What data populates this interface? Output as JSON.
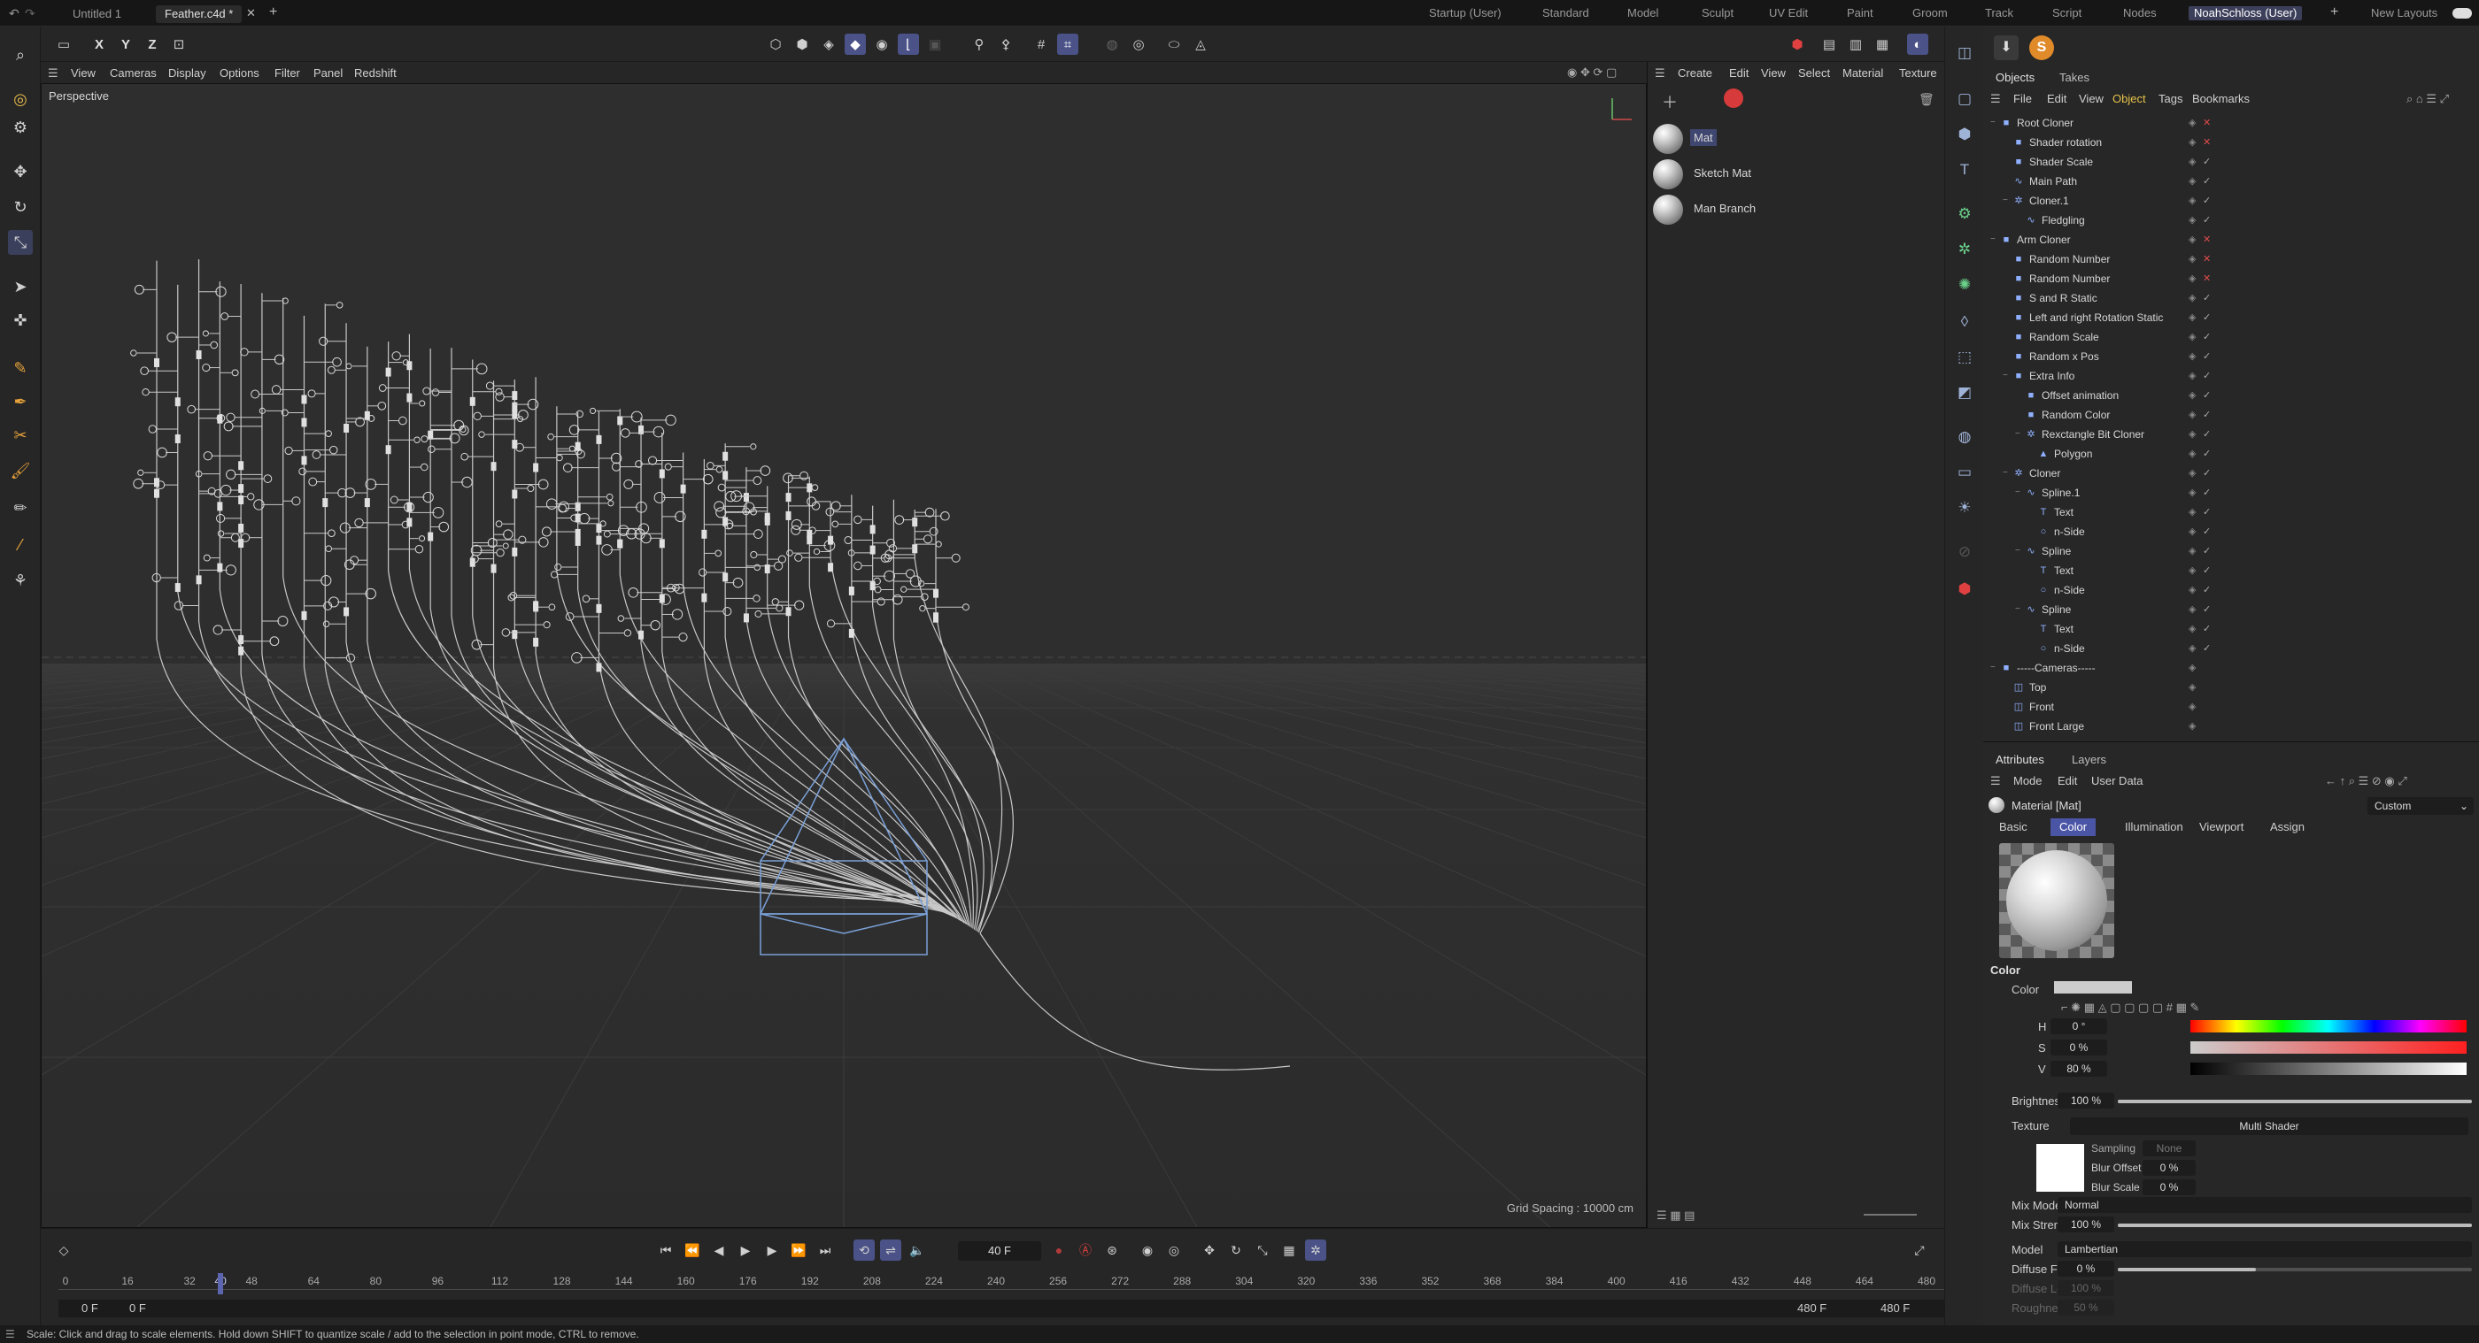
{
  "doc_tabs": [
    "Untitled 1",
    "Feather.c4d *"
  ],
  "layouts": [
    "Startup (User)",
    "Standard",
    "Model",
    "Sculpt",
    "UV Edit",
    "Paint",
    "Groom",
    "Track",
    "Script",
    "Nodes",
    "NoahSchloss (User)",
    "New Layouts"
  ],
  "axis_buttons": [
    "X",
    "Y",
    "Z"
  ],
  "viewport_menu": [
    "View",
    "Cameras",
    "Display",
    "Options",
    "Filter",
    "Panel",
    "Redshift"
  ],
  "viewport": {
    "label": "Perspective",
    "grid_spacing": "Grid Spacing : 10000 cm"
  },
  "material_menu": [
    "Create",
    "Edit",
    "View",
    "Select",
    "Material",
    "Texture"
  ],
  "materials": [
    "Mat",
    "Sketch Mat",
    "Man Branch"
  ],
  "obj_tabs": [
    "Objects",
    "Takes"
  ],
  "obj_menu": [
    "File",
    "Edit",
    "View",
    "Object",
    "Tags",
    "Bookmarks"
  ],
  "objects": [
    {
      "name": "Root Cloner",
      "depth": 0,
      "exp": "−",
      "icon": "■",
      "flag": "✕"
    },
    {
      "name": "Shader rotation",
      "depth": 1,
      "exp": "",
      "icon": "■",
      "flag": "✕"
    },
    {
      "name": "Shader Scale",
      "depth": 1,
      "exp": "",
      "icon": "■",
      "flag": "✓"
    },
    {
      "name": "Main Path",
      "depth": 1,
      "exp": "",
      "icon": "∿",
      "flag": "✓"
    },
    {
      "name": "Cloner.1",
      "depth": 1,
      "exp": "−",
      "icon": "✲",
      "flag": "✓"
    },
    {
      "name": "Fledgling",
      "depth": 2,
      "exp": "",
      "icon": "∿",
      "flag": "✓"
    },
    {
      "name": "Arm Cloner",
      "depth": 0,
      "exp": "−",
      "icon": "■",
      "flag": "✕"
    },
    {
      "name": "Random Number",
      "depth": 1,
      "exp": "",
      "icon": "■",
      "flag": "✕"
    },
    {
      "name": "Random Number",
      "depth": 1,
      "exp": "",
      "icon": "■",
      "flag": "✕"
    },
    {
      "name": "S and R Static",
      "depth": 1,
      "exp": "",
      "icon": "■",
      "flag": "✓"
    },
    {
      "name": "Left and right Rotation Static",
      "depth": 1,
      "exp": "",
      "icon": "■",
      "flag": "✓"
    },
    {
      "name": "Random Scale",
      "depth": 1,
      "exp": "",
      "icon": "■",
      "flag": "✓"
    },
    {
      "name": "Random  x Pos",
      "depth": 1,
      "exp": "",
      "icon": "■",
      "flag": "✓"
    },
    {
      "name": "Extra Info",
      "depth": 1,
      "exp": "−",
      "icon": "■",
      "flag": "✓"
    },
    {
      "name": "Offset animation",
      "depth": 2,
      "exp": "",
      "icon": "■",
      "flag": "✓"
    },
    {
      "name": "Random Color",
      "depth": 2,
      "exp": "",
      "icon": "■",
      "flag": "✓"
    },
    {
      "name": "Rexctangle Bit Cloner",
      "depth": 2,
      "exp": "−",
      "icon": "✲",
      "flag": "✓"
    },
    {
      "name": "Polygon",
      "depth": 3,
      "exp": "",
      "icon": "▲",
      "flag": "✓"
    },
    {
      "name": "Cloner",
      "depth": 1,
      "exp": "−",
      "icon": "✲",
      "flag": "✓"
    },
    {
      "name": "Spline.1",
      "depth": 2,
      "exp": "−",
      "icon": "∿",
      "flag": "✓"
    },
    {
      "name": "Text",
      "depth": 3,
      "exp": "",
      "icon": "T",
      "flag": "✓"
    },
    {
      "name": "n-Side",
      "depth": 3,
      "exp": "",
      "icon": "○",
      "flag": "✓"
    },
    {
      "name": "Spline",
      "depth": 2,
      "exp": "−",
      "icon": "∿",
      "flag": "✓"
    },
    {
      "name": "Text",
      "depth": 3,
      "exp": "",
      "icon": "T",
      "flag": "✓"
    },
    {
      "name": "n-Side",
      "depth": 3,
      "exp": "",
      "icon": "○",
      "flag": "✓"
    },
    {
      "name": "Spline",
      "depth": 2,
      "exp": "−",
      "icon": "∿",
      "flag": "✓"
    },
    {
      "name": "Text",
      "depth": 3,
      "exp": "",
      "icon": "T",
      "flag": "✓"
    },
    {
      "name": "n-Side",
      "depth": 3,
      "exp": "",
      "icon": "○",
      "flag": "✓"
    },
    {
      "name": "-----Cameras-----",
      "depth": 0,
      "exp": "−",
      "icon": "■",
      "flag": ""
    },
    {
      "name": "Top",
      "depth": 1,
      "exp": "",
      "icon": "◫",
      "flag": ""
    },
    {
      "name": "Front",
      "depth": 1,
      "exp": "",
      "icon": "◫",
      "flag": ""
    },
    {
      "name": "Front Large",
      "depth": 1,
      "exp": "",
      "icon": "◫",
      "flag": ""
    }
  ],
  "attr_tabs": [
    "Attributes",
    "Layers"
  ],
  "attr_menu": [
    "Mode",
    "Edit",
    "User Data"
  ],
  "attr": {
    "title": "Material [Mat]",
    "preset": "Custom",
    "sub_tabs": [
      "Basic",
      "Color",
      "Illumination",
      "Viewport",
      "Assign"
    ],
    "section": "Color",
    "color_label": "Color",
    "hsv": [
      {
        "k": "H",
        "v": "0 °"
      },
      {
        "k": "S",
        "v": "0 %"
      },
      {
        "k": "V",
        "v": "80 %"
      }
    ],
    "brightness_label": "Brightness",
    "brightness": "100 %",
    "texture_label": "Texture",
    "texture_value": "Multi Shader",
    "sampling_label": "Sampling",
    "sampling_value": "None",
    "blur_offset_label": "Blur Offset",
    "blur_offset": "0 %",
    "blur_scale_label": "Blur Scale",
    "blur_scale": "0 %",
    "mix_mode_label": "Mix Mode",
    "mix_mode": "Normal",
    "mix_strength_label": "Mix Strength",
    "mix_strength": "100 %",
    "model_label": "Model",
    "model": "Lambertian",
    "diffuse_falloff_label": "Diffuse Falloff",
    "diffuse_falloff": "0 %",
    "diffuse_level_label": "Diffuse Level",
    "diffuse_level": "100 %",
    "roughness_label": "Roughness",
    "roughness": "50 %"
  },
  "timeline": {
    "frame": "40 F",
    "ticks": [
      "0",
      "16",
      "32",
      "40",
      "48",
      "64",
      "80",
      "96",
      "112",
      "128",
      "144",
      "160",
      "176",
      "192",
      "208",
      "224",
      "240",
      "256",
      "272",
      "288",
      "304",
      "320",
      "336",
      "352",
      "368",
      "384",
      "400",
      "416",
      "432",
      "448",
      "464",
      "480"
    ],
    "start": "0 F",
    "start2": "0 F",
    "end": "480 F",
    "end2": "480 F"
  },
  "status": "Scale: Click and drag to scale elements. Hold down SHIFT to quantize scale / add to the selection in point mode, CTRL to remove."
}
